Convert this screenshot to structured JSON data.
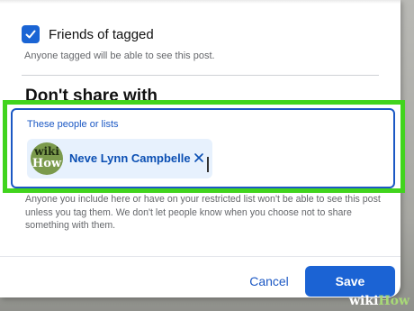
{
  "friends_of_tagged": {
    "checked": true,
    "label": "Friends of tagged",
    "helper": "Anyone tagged will be able to see this post."
  },
  "dont_share": {
    "heading": "Don't share with",
    "input_label": "These people or lists",
    "chip": {
      "name": "Neve Lynn Campbelle",
      "avatar_text_line1": "wiki",
      "avatar_text_line2": "How"
    },
    "footnote": "Anyone you include here or have on your restricted list won't be able to see this post unless you tag them. We don't let people know when you choose not to share something with them."
  },
  "footer": {
    "cancel_label": "Cancel",
    "save_label": "Save"
  },
  "watermark": {
    "part1": "wiki",
    "part2": "How"
  },
  "colors": {
    "accent": "#1b63d4",
    "highlight": "#41d41d",
    "chip_background": "#e7f1fd"
  },
  "icons": [
    "check-icon",
    "close-icon"
  ]
}
